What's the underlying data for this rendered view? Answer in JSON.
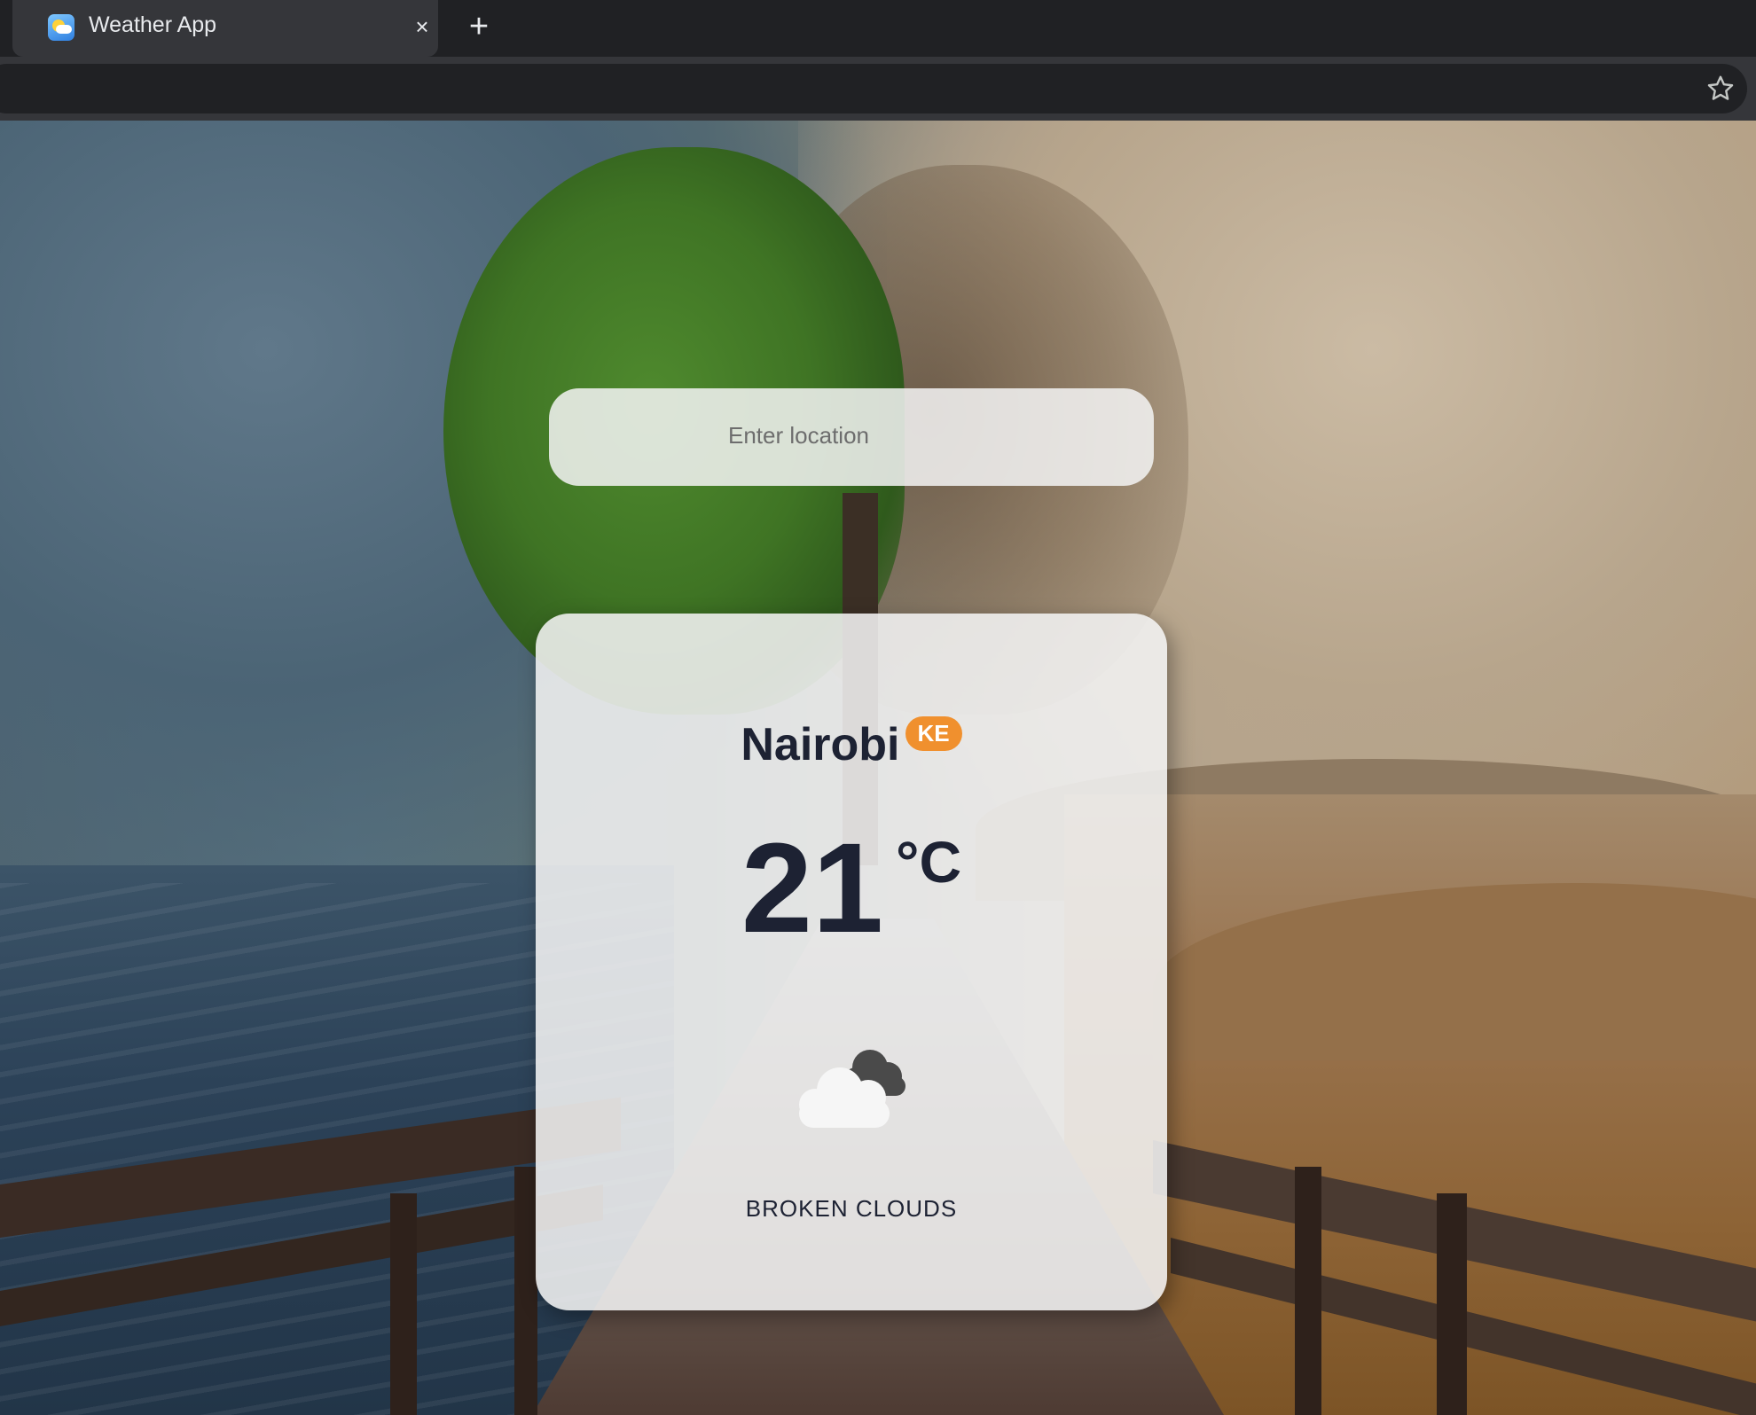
{
  "browser": {
    "tab": {
      "title": "Weather App",
      "favicon": "weather-app-icon",
      "close_icon": "×"
    },
    "new_tab_icon": "+",
    "bookmark_icon": "star-icon"
  },
  "search": {
    "placeholder": "Enter location"
  },
  "weather": {
    "city": "Nairobi",
    "country": "KE",
    "temperature": "21",
    "unit": "°C",
    "icon": "broken-clouds-icon",
    "description": "BROKEN CLOUDS"
  },
  "colors": {
    "country_badge": "#f0902e",
    "text_dark": "#1d2233",
    "card_bg": "#f2f2f2"
  }
}
